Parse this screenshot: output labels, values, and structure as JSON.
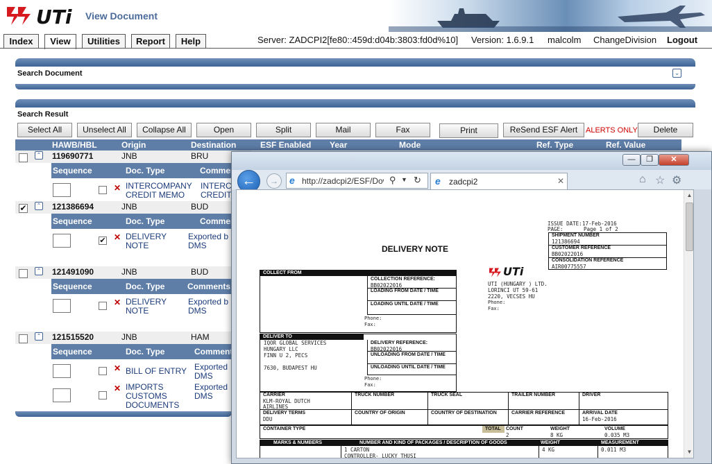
{
  "header": {
    "logo_text": "UTi",
    "app_title": "View Document"
  },
  "menu": {
    "tabs": [
      "Index",
      "View",
      "Utilities",
      "Report",
      "Help"
    ],
    "server": "Server: ZADCPI2[fe80::459d:d04b:3803:fd0d%10]",
    "version": "Version: 1.6.9.1",
    "user": "malcolm",
    "change_division": "ChangeDivision",
    "logout": "Logout"
  },
  "search_document": {
    "title": "Search Document"
  },
  "search_result": {
    "title": "Search Result",
    "buttons": [
      "Select All",
      "Unselect All",
      "Collapse All",
      "Open",
      "Split",
      "Mail",
      "Fax",
      "Print",
      "ReSend ESF Alert",
      "Delete"
    ],
    "alerts_only": "ALERTS ONLY",
    "columns": [
      "HAWB/HBL",
      "Origin",
      "Destination",
      "ESF Enabled",
      "Year",
      "Mode",
      "Ref. Type",
      "Ref. Value"
    ],
    "sub_columns": [
      "Sequence",
      "Doc. Type",
      "Comments"
    ],
    "shipments": [
      {
        "hawb": "119690771",
        "origin": "JNB",
        "destination": "BRU",
        "checked": false,
        "docs": [
          {
            "type_line1": "INTERCOMPANY",
            "type_line2": "CREDIT MEMO",
            "comment_line1": "INTERC",
            "comment_line2": "CREDIT",
            "checked": false
          }
        ]
      },
      {
        "hawb": "121386694",
        "origin": "JNB",
        "destination": "BUD",
        "checked": true,
        "docs": [
          {
            "type_line1": "DELIVERY",
            "type_line2": "NOTE",
            "comment_line1": "Exported b",
            "comment_line2": "DMS",
            "checked": true
          }
        ]
      },
      {
        "hawb": "121491090",
        "origin": "JNB",
        "destination": "BUD",
        "checked": false,
        "docs": [
          {
            "type_line1": "DELIVERY",
            "type_line2": "NOTE",
            "comment_line1": "Exported b",
            "comment_line2": "DMS",
            "checked": false
          }
        ]
      },
      {
        "hawb": "121515520",
        "origin": "JNB",
        "destination": "HAM",
        "checked": false,
        "docs": [
          {
            "type_line1": "BILL OF ENTRY",
            "type_line2": "",
            "comment_line1": "Exported",
            "comment_line2": "DMS",
            "checked": false
          },
          {
            "type_line1": "IMPORTS",
            "type_line2": "CUSTOMS",
            "type_line3": "DOCUMENTS",
            "comment_line1": "Exported",
            "comment_line2": "DMS",
            "checked": false
          }
        ]
      }
    ]
  },
  "popup": {
    "address": "http://zadcpi2/ESF/Dow",
    "tab_title": "zadcpi2",
    "document": {
      "title": "DELIVERY NOTE",
      "issue_date_label": "ISSUE DATE:",
      "issue_date": "17-Feb-2016",
      "page_label": "PAGE:",
      "page_value": "Page 1 of 2",
      "shipment_number_label": "SHIPMENT NUMBER",
      "shipment_number": "121386694",
      "customer_reference_label": "CUSTOMER REFERENCE",
      "customer_reference": "BB02022016",
      "consolidation_reference_label": "CONSOLIDATION REFERENCE",
      "consolidation_reference": "AIR00775557",
      "collect_from_label": "COLLECT FROM",
      "collection_reference_label": "COLLECTION REFERENCE:",
      "collection_reference": "BB02022016",
      "loading_from_label": "LOADING FROM DATE / TIME",
      "loading_until_label": "LOADING UNTIL DATE / TIME",
      "phone_label": "Phone:",
      "fax_label": "Fax:",
      "company_name": "UTI (HUNGARY ) LTD.",
      "company_addr1": "LORINCI UT 59-61",
      "company_addr2": "2220, VECSES HU",
      "deliver_to_label": "DELIVER TO",
      "deliver_to": [
        "IQOR GLOBAL SERVICES",
        "HUNGARY LLC",
        "FINN U 2, PECS",
        "",
        "7630, BUDAPEST HU"
      ],
      "delivery_reference_label": "DELIVERY REFERENCE:",
      "delivery_reference": "BB02022016",
      "unloading_from_label": "UNLOADING FROM DATE / TIME",
      "unloading_until_label": "UNLOADING UNTIL DATE / TIME",
      "carrier_label": "CARRIER",
      "carrier": [
        "KLM-ROYAL DUTCH",
        "AIRLINES"
      ],
      "truck_number_label": "TRUCK NUMBER",
      "truck_seal_label": "TRUCK SEAL",
      "trailer_number_label": "TRAILER NUMBER",
      "driver_label": "DRIVER",
      "delivery_terms_label": "DELIVERY TERMS",
      "delivery_terms": "DDU",
      "country_origin_label": "COUNTRY OF ORIGIN",
      "country_destination_label": "COUNTRY OF DESTINATION",
      "carrier_reference_label": "CARRIER REFERENCE",
      "arrival_date_label": "ARRIVAL DATE",
      "arrival_date": "16-Feb-2016",
      "container_type_label": "CONTAINER TYPE",
      "total_label": "TOTAL",
      "count_label": "COUNT",
      "count": "2",
      "weight_label": "WEIGHT",
      "weight": "8 KG",
      "volume_label": "VOLUME",
      "volume": "0.035 M3",
      "marks_label": "MARKS & NUMBERS",
      "packages_label": "NUMBER AND KIND OF PACKAGES / DESCRIPTION OF GOODS",
      "line_weight_label": "WEIGHT",
      "measurement_label": "MEASUREMENT",
      "line_packages": "1 CARTON",
      "line_description": "CONTROLLER- LUCKY THUSI",
      "line_weight": "4 KG",
      "line_measurement": "0.011 M3"
    }
  },
  "colors": {
    "header_bar": "#5e7ea8",
    "alert_red": "#d00000",
    "link_blue": "#1b3b7a"
  }
}
